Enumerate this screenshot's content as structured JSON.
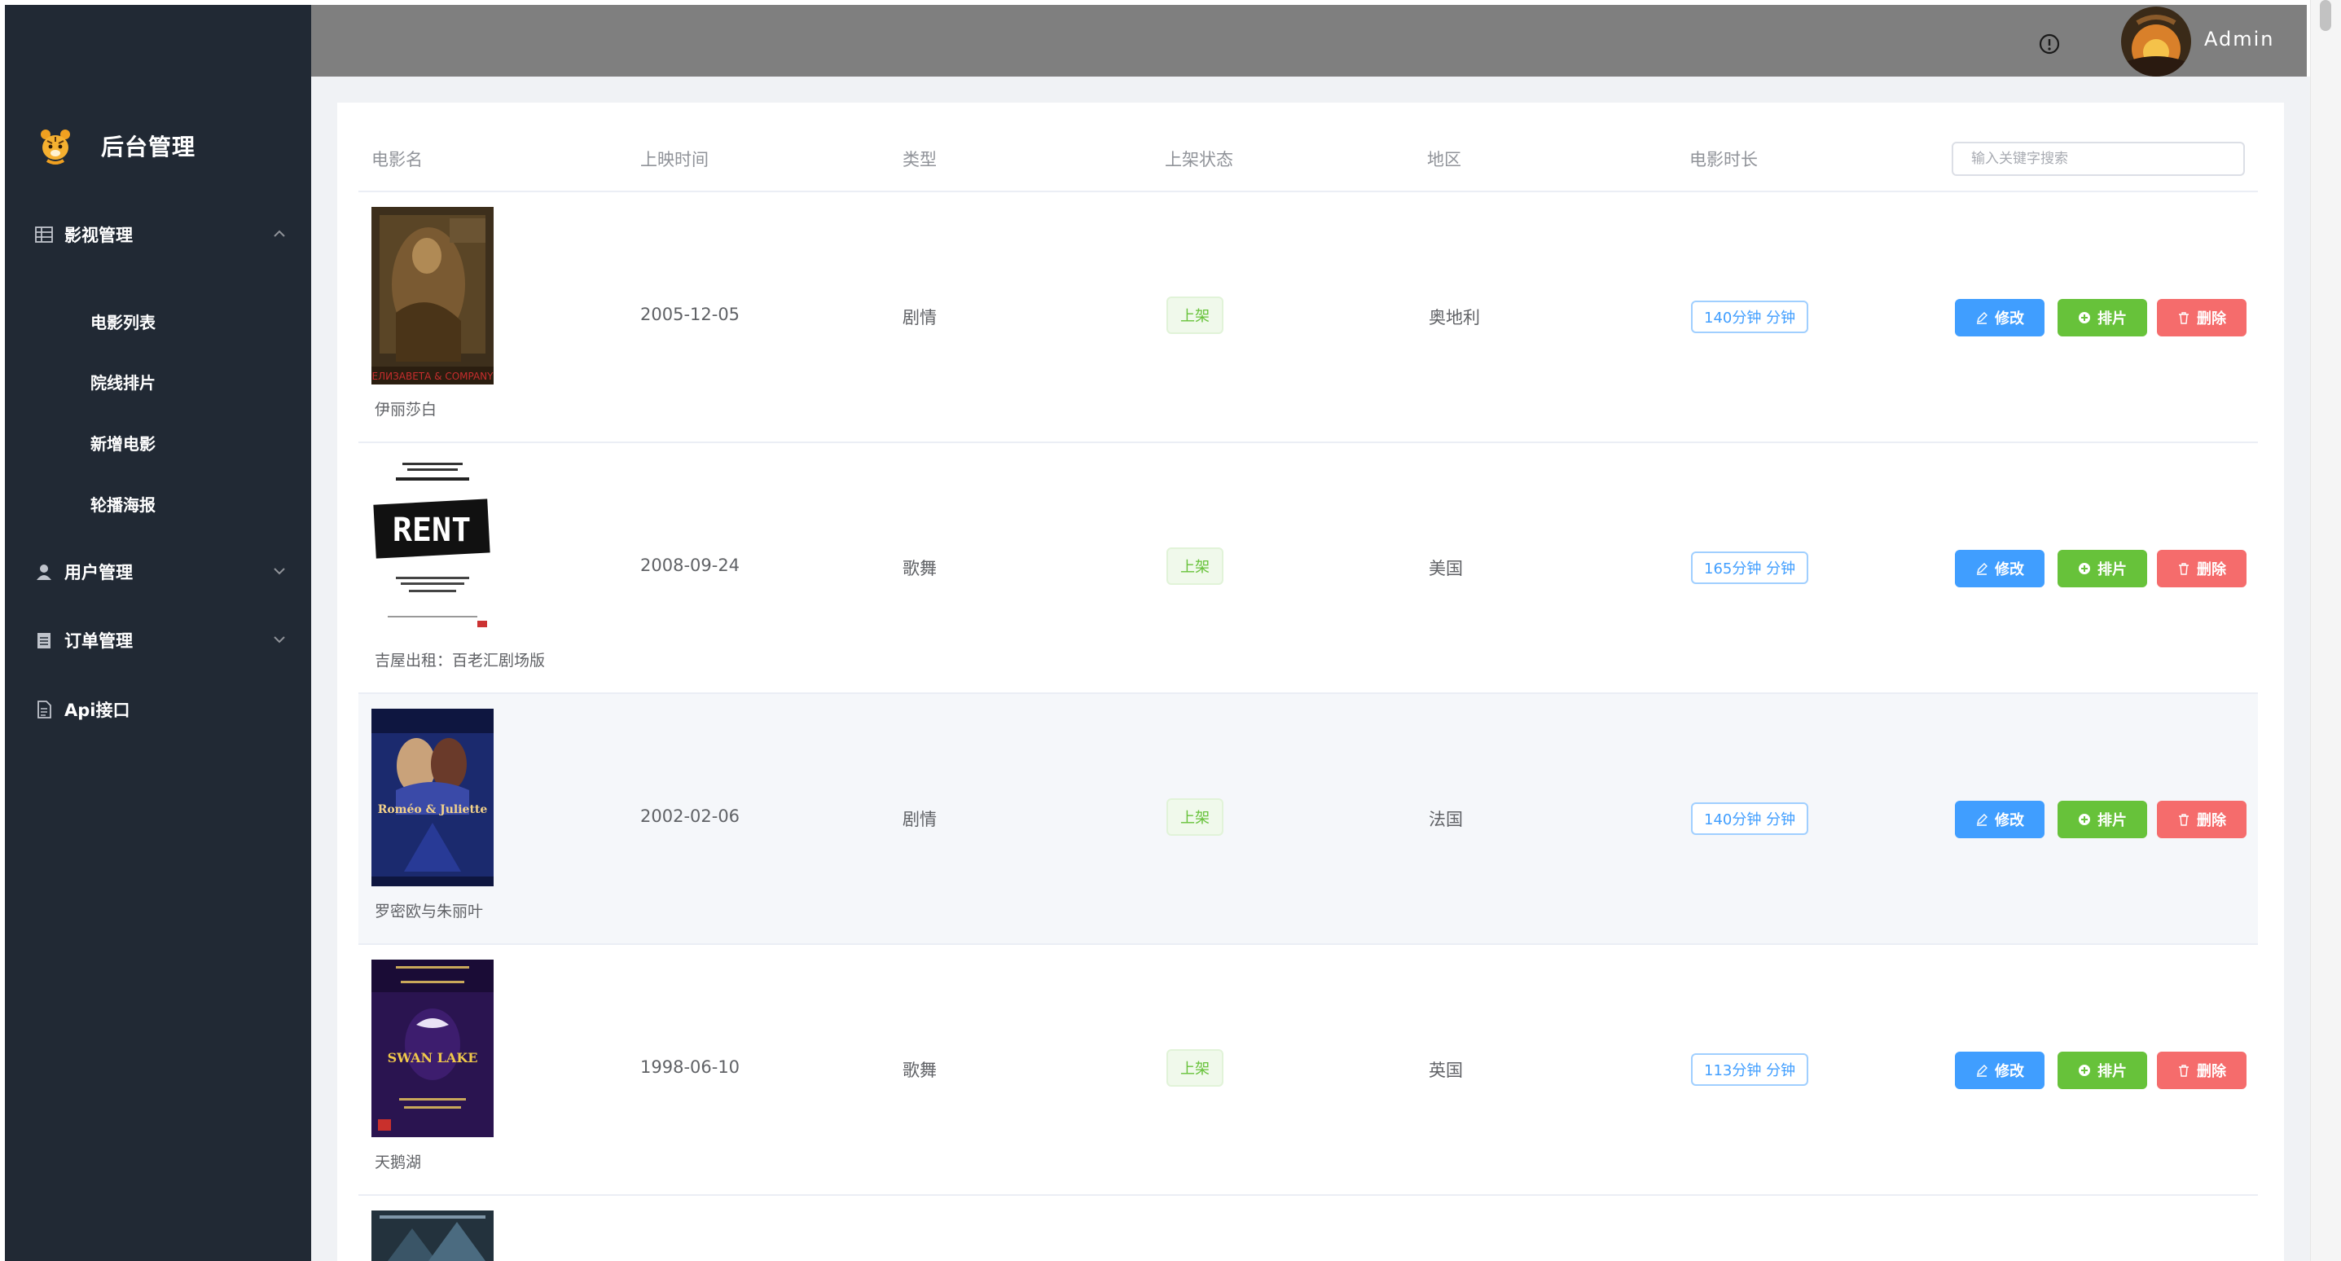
{
  "sidebar": {
    "brand": "后台管理",
    "groups": [
      {
        "label": "影视管理",
        "items": [
          "电影列表",
          "院线排片",
          "新增电影",
          "轮播海报"
        ]
      },
      {
        "label": "用户管理"
      },
      {
        "label": "订单管理"
      },
      {
        "label": "Api接口"
      }
    ]
  },
  "header": {
    "user": "Admin"
  },
  "table": {
    "headers": [
      "电影名",
      "上映时间",
      "类型",
      "上架状态",
      "地区",
      "电影时长"
    ],
    "search_placeholder": "输入关键字搜索",
    "rows": [
      {
        "name": "伊丽莎白",
        "date": "2005-12-05",
        "genre": "剧情",
        "status": "上架",
        "region": "奥地利",
        "duration": "140分钟 分钟",
        "poster_text": "ЕЛИЗАВЕТА & COMPANY"
      },
      {
        "name": "吉屋出租：百老汇剧场版",
        "date": "2008-09-24",
        "genre": "歌舞",
        "status": "上架",
        "region": "美国",
        "duration": "165分钟 分钟",
        "poster_text": "RENT"
      },
      {
        "name": "罗密欧与朱丽叶",
        "date": "2002-02-06",
        "genre": "剧情",
        "status": "上架",
        "region": "法国",
        "duration": "140分钟 分钟",
        "poster_text": "Roméo & Juliette"
      },
      {
        "name": "天鹅湖",
        "date": "1998-06-10",
        "genre": "歌舞",
        "status": "上架",
        "region": "英国",
        "duration": "113分钟 分钟",
        "poster_text": "SWAN LAKE"
      }
    ],
    "actions": {
      "edit": "修改",
      "schedule": "排片",
      "delete": "删除"
    }
  }
}
